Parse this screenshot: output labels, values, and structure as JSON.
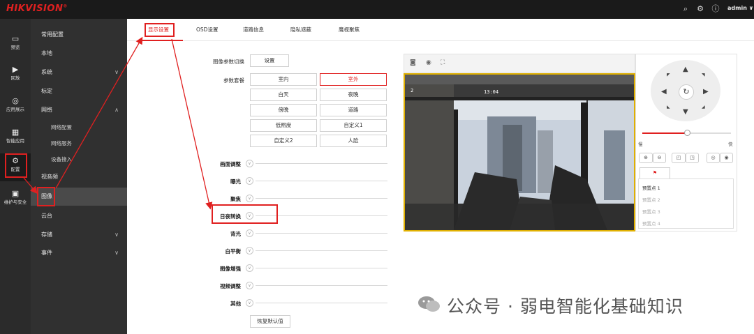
{
  "topbar": {
    "logo": "HIKVISION",
    "logo_mark": "®",
    "user": "admin ∨",
    "icons": [
      "search-icon",
      "settings-icon",
      "info-icon"
    ]
  },
  "rail": [
    {
      "label": "预览",
      "icon": "monitor-icon"
    },
    {
      "label": "回放",
      "icon": "play-icon"
    },
    {
      "label": "应用展示",
      "icon": "app-icon"
    },
    {
      "label": "智能应用",
      "icon": "grid-icon"
    },
    {
      "label": "配置",
      "icon": "gear-icon"
    },
    {
      "label": "维护与安全",
      "icon": "tools-icon"
    }
  ],
  "menu": [
    {
      "label": "常用配置"
    },
    {
      "label": "本地"
    },
    {
      "label": "系统",
      "chev": "∨"
    },
    {
      "label": "标定"
    },
    {
      "label": "网络",
      "chev": "∧"
    },
    {
      "label": "网络配置"
    },
    {
      "label": "网络服务"
    },
    {
      "label": "设备接入"
    },
    {
      "label": "视音频"
    },
    {
      "label": "图像"
    },
    {
      "label": "云台"
    },
    {
      "label": "存储",
      "chev": "∨"
    },
    {
      "label": "事件",
      "chev": "∨"
    }
  ],
  "tabs": [
    "显示设置",
    "OSD设置",
    "道路信息",
    "隐私遮蔽",
    "鹰视聚焦"
  ],
  "form": {
    "image_param_switch_label": "图像参数切换",
    "image_param_switch_button": "设置",
    "param_set_label": "参数套餐",
    "param_options": [
      "室内",
      "室外",
      "白天",
      "夜晚",
      "傍晚",
      "道路",
      "低照度",
      "自定义1",
      "自定义2",
      "人脸"
    ],
    "selected_option": "室外",
    "sections": [
      "画面调整",
      "曝光",
      "聚焦",
      "日夜转换",
      "背光",
      "白平衡",
      "图像增强",
      "视频调整",
      "其他"
    ],
    "restore_button": "恢复默认值"
  },
  "video": {
    "osd_left": "2",
    "osd_time": "13:04"
  },
  "ptz": {
    "slow_label": "慢",
    "fast_label": "快",
    "speed_percent": 50,
    "preset_tab_icon": "flag-icon",
    "presets": [
      "预置点 1",
      "预置点 2",
      "预置点 3",
      "预置点 4"
    ]
  },
  "watermark": "公众号 · 弱电智能化基础知识",
  "colors": {
    "accent": "#e02020",
    "topbar": "#1a1a1a",
    "menu": "#303030",
    "video_border": "#e0b000"
  }
}
